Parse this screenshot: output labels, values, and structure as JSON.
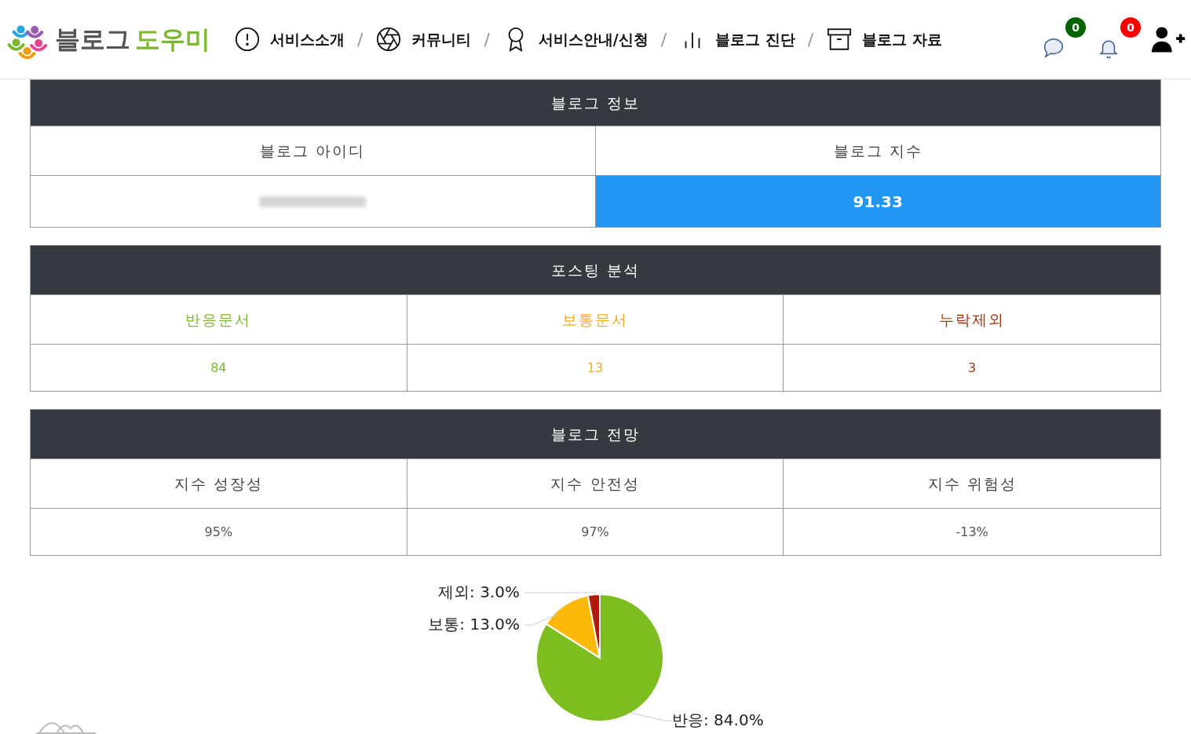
{
  "logo": {
    "text_1": "블로그",
    "text_2": "도우미"
  },
  "nav": [
    {
      "label": "서비스소개",
      "kind": "info",
      "separator": "/"
    },
    {
      "label": "커뮤니티",
      "kind": "aperture",
      "separator": "/"
    },
    {
      "label": "서비스안내/신청",
      "kind": "award",
      "separator": "/"
    },
    {
      "label": "블로그 진단",
      "kind": "chart",
      "separator": "/"
    },
    {
      "label": "블로그 자료",
      "kind": "archive"
    }
  ],
  "badges": [
    {
      "kind": "chat",
      "count": "0",
      "color": "#006400"
    },
    {
      "kind": "bell",
      "count": "0",
      "color": "#ff0000"
    }
  ],
  "blog_info": {
    "title": "블로그 정보",
    "columns": [
      "블로그 아이디",
      "블로그 지수"
    ],
    "score": "91.33"
  },
  "posting": {
    "title": "포스팅 분석",
    "columns": [
      {
        "label": "반응문서",
        "value": "84",
        "color": "#7cb82f"
      },
      {
        "label": "보통문서",
        "value": "13",
        "color": "#f0ad1e"
      },
      {
        "label": "누락제외",
        "value": "3",
        "color": "#a0330f"
      }
    ]
  },
  "outlook": {
    "title": "블로그 전망",
    "columns": [
      {
        "label": "지수 성장성",
        "value": "95%"
      },
      {
        "label": "지수 안전성",
        "value": "97%"
      },
      {
        "label": "지수 위험성",
        "value": "-13%"
      }
    ]
  },
  "pie": {
    "chart_data": {
      "type": "pie",
      "values": [
        84,
        13,
        3
      ],
      "colors": [
        "#7cbe1f",
        "#fdb90a",
        "#b01a0a"
      ],
      "data_labels": true,
      "value_labels": [
        "반응: 84.0%",
        "보통: 13.0%",
        "제외: 3.0%"
      ]
    }
  }
}
